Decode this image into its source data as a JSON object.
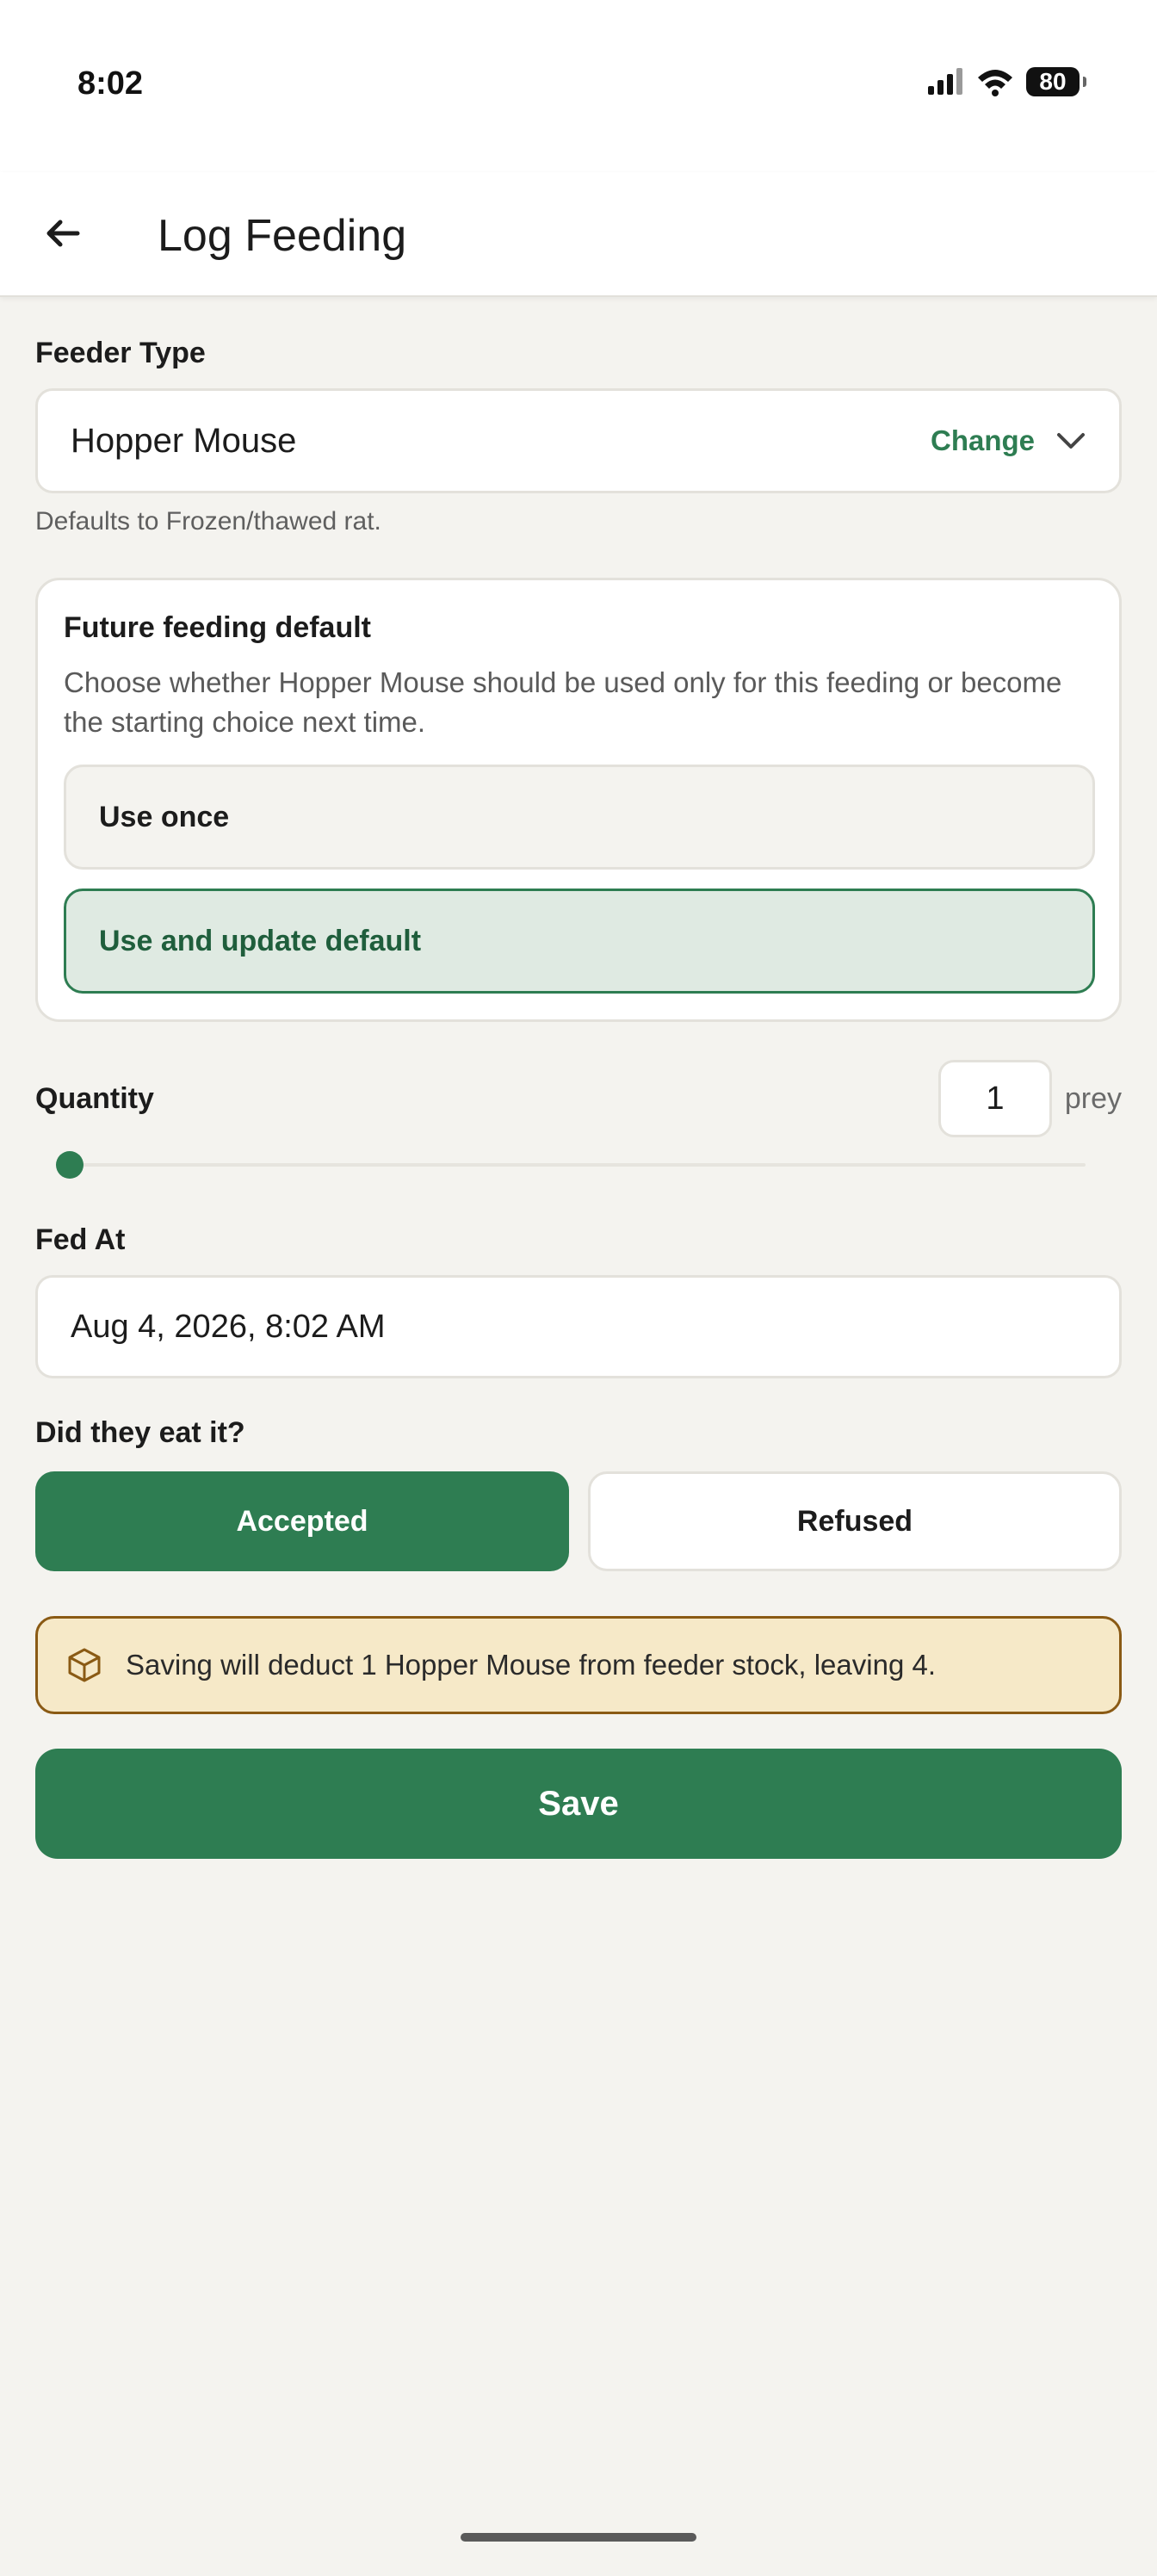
{
  "status_bar": {
    "time": "8:02",
    "battery": "80"
  },
  "app_bar": {
    "title": "Log Feeding",
    "back_icon": "arrow-left-icon"
  },
  "feeder": {
    "label": "Feeder Type",
    "value": "Hopper Mouse",
    "change_label": "Change",
    "hint": "Defaults to Frozen/thawed rat."
  },
  "future_default": {
    "title": "Future feeding default",
    "description": "Choose whether Hopper Mouse should be used only for this feeding or become the starting choice next time.",
    "options": [
      "Use once",
      "Use and update default"
    ],
    "selected": "Use and update default"
  },
  "quantity": {
    "label": "Quantity",
    "value": "1",
    "unit": "prey",
    "slider_fraction": 0
  },
  "fed_at": {
    "label": "Fed At",
    "value": "Aug 4, 2026, 8:02 AM"
  },
  "ate": {
    "label": "Did they eat it?",
    "accepted": "Accepted",
    "refused": "Refused",
    "selected": "Accepted"
  },
  "notice": {
    "icon": "package-icon",
    "text": "Saving will deduct 1 Hopper Mouse from feeder stock, leaving 4."
  },
  "save": {
    "label": "Save"
  },
  "colors": {
    "primary": "#2e7d52",
    "background": "#f4f3ef",
    "notice_bg": "#f6e9c8",
    "notice_border": "#8a5a14"
  }
}
